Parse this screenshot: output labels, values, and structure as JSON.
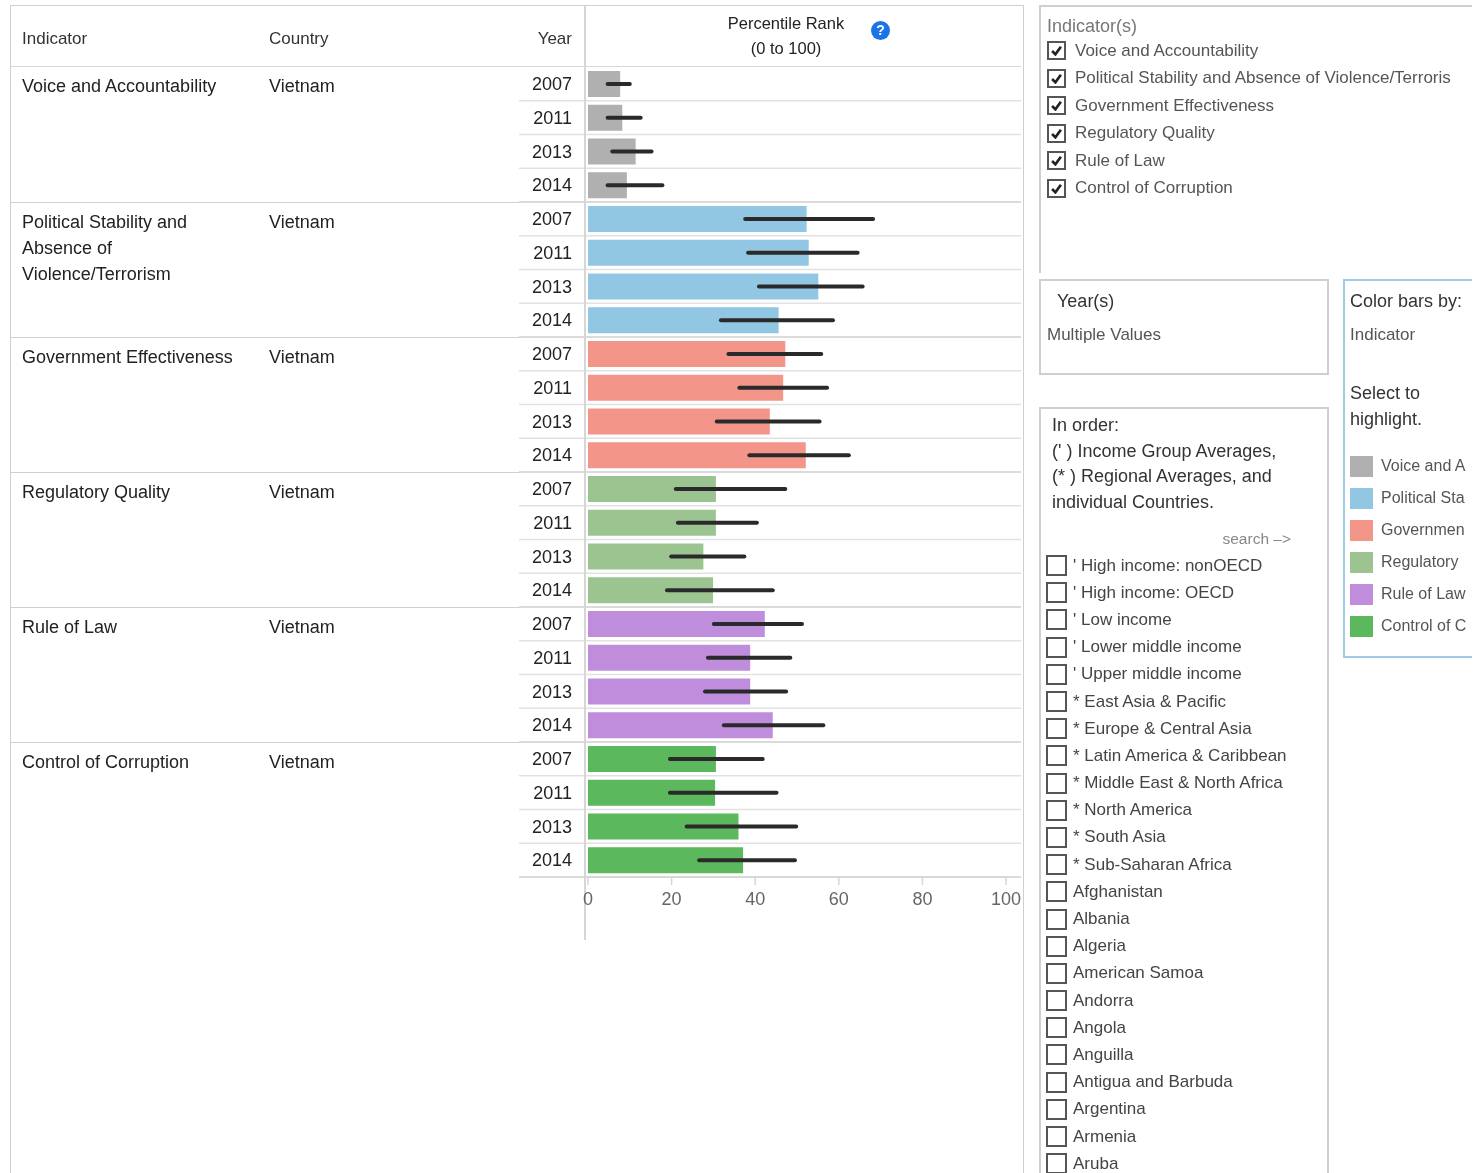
{
  "table": {
    "columns": [
      "Indicator",
      "Country",
      "Year"
    ],
    "groups": [
      {
        "country": "Vietnam"
      },
      {
        "country": "Vietnam"
      },
      {
        "country": "Vietnam"
      },
      {
        "country": "Vietnam"
      },
      {
        "country": "Vietnam"
      },
      {
        "country": "Vietnam"
      }
    ],
    "chart_header": "Percentile Rank\n(0 to 100)",
    "help_icon": "?",
    "chart_data": {
      "type": "bar",
      "orientation": "horizontal",
      "xlim": [
        0,
        100
      ],
      "xticks": [
        0,
        20,
        40,
        60,
        80,
        100
      ],
      "categories": [
        "2007",
        "2011",
        "2013",
        "2014",
        "2007",
        "2011",
        "2013",
        "2014",
        "2007",
        "2011",
        "2013",
        "2014",
        "2007",
        "2011",
        "2013",
        "2014",
        "2007",
        "2011",
        "2013",
        "2014",
        "2007",
        "2011",
        "2013",
        "2014"
      ],
      "series": [
        {
          "name": "Voice and Accountability",
          "color": "#b0b0b0",
          "values": [
            7.7,
            8.2,
            11.4,
            9.3,
            null,
            null,
            null,
            null,
            null,
            null,
            null,
            null,
            null,
            null,
            null,
            null,
            null,
            null,
            null,
            null,
            null,
            null,
            null,
            null
          ],
          "errors": [
            [
              4.7,
              10
            ],
            [
              4.7,
              12.6
            ],
            [
              5.8,
              15.2
            ],
            [
              4.7,
              17.8
            ],
            null,
            null,
            null,
            null,
            null,
            null,
            null,
            null,
            null,
            null,
            null,
            null,
            null,
            null,
            null,
            null,
            null,
            null,
            null,
            null
          ]
        },
        {
          "name": "Political Stability and Absence of Violence/Terrorism",
          "color": "#92c7e3",
          "values": [
            null,
            null,
            null,
            null,
            52.3,
            52.8,
            55.1,
            45.6,
            null,
            null,
            null,
            null,
            null,
            null,
            null,
            null,
            null,
            null,
            null,
            null,
            null,
            null,
            null,
            null
          ],
          "errors": [
            null,
            null,
            null,
            null,
            [
              37.6,
              68.2
            ],
            [
              38.3,
              64.5
            ],
            [
              40.9,
              65.7
            ],
            [
              31.8,
              58.6
            ],
            null,
            null,
            null,
            null,
            null,
            null,
            null,
            null,
            null,
            null,
            null,
            null,
            null,
            null,
            null,
            null
          ]
        },
        {
          "name": "Government Effectiveness",
          "color": "#f4958a",
          "values": [
            null,
            null,
            null,
            null,
            null,
            null,
            null,
            null,
            47.2,
            46.7,
            43.5,
            52.1,
            null,
            null,
            null,
            null,
            null,
            null,
            null,
            null,
            null,
            null,
            null,
            null
          ],
          "errors": [
            null,
            null,
            null,
            null,
            null,
            null,
            null,
            null,
            [
              33.6,
              55.8
            ],
            [
              36.2,
              57.2
            ],
            [
              30.8,
              55.4
            ],
            [
              38.6,
              62.4
            ],
            null,
            null,
            null,
            null,
            null,
            null,
            null,
            null,
            null,
            null,
            null,
            null
          ]
        },
        {
          "name": "Regulatory Quality",
          "color": "#9cc490",
          "values": [
            null,
            null,
            null,
            null,
            null,
            null,
            null,
            null,
            null,
            null,
            null,
            null,
            30.6,
            30.6,
            27.6,
            29.9,
            null,
            null,
            null,
            null,
            null,
            null,
            null,
            null
          ],
          "errors": [
            null,
            null,
            null,
            null,
            null,
            null,
            null,
            null,
            null,
            null,
            null,
            null,
            [
              21,
              47.2
            ],
            [
              21.5,
              40.4
            ],
            [
              19.9,
              37.4
            ],
            [
              18.9,
              44.2
            ],
            null,
            null,
            null,
            null,
            null,
            null,
            null,
            null
          ]
        },
        {
          "name": "Rule of Law",
          "color": "#c08ddd",
          "values": [
            null,
            null,
            null,
            null,
            null,
            null,
            null,
            null,
            null,
            null,
            null,
            null,
            null,
            null,
            null,
            null,
            42.3,
            38.8,
            38.8,
            44.2,
            null,
            null,
            null,
            null
          ],
          "errors": [
            null,
            null,
            null,
            null,
            null,
            null,
            null,
            null,
            null,
            null,
            null,
            null,
            null,
            null,
            null,
            null,
            [
              30.1,
              51.2
            ],
            [
              28.7,
              48.4
            ],
            [
              28,
              47.4
            ],
            [
              32.5,
              56.3
            ],
            null,
            null,
            null,
            null
          ]
        },
        {
          "name": "Control of Corruption",
          "color": "#5cb85c",
          "values": [
            null,
            null,
            null,
            null,
            null,
            null,
            null,
            null,
            null,
            null,
            null,
            null,
            null,
            null,
            null,
            null,
            null,
            null,
            null,
            null,
            30.6,
            30.4,
            36,
            37.1
          ],
          "errors": [
            null,
            null,
            null,
            null,
            null,
            null,
            null,
            null,
            null,
            null,
            null,
            null,
            null,
            null,
            null,
            null,
            null,
            null,
            null,
            null,
            [
              19.6,
              41.8
            ],
            [
              19.6,
              45.1
            ],
            [
              23.6,
              49.8
            ],
            [
              26.6,
              49.5
            ]
          ]
        }
      ]
    }
  },
  "indicator_filter": {
    "title": "Indicator(s)",
    "items": [
      {
        "label": "Voice and Accountability",
        "checked": true
      },
      {
        "label": "Political Stability and Absence of Violence/Terroris",
        "checked": true
      },
      {
        "label": "Government Effectiveness",
        "checked": true
      },
      {
        "label": "Regulatory Quality",
        "checked": true
      },
      {
        "label": "Rule of Law",
        "checked": true
      },
      {
        "label": "Control of Corruption",
        "checked": true
      }
    ]
  },
  "year_filter": {
    "title": "Year(s)",
    "value": "Multiple Values"
  },
  "country_filter": {
    "intro": "In order:\n(' ) Income Group Averages,\n(* ) Regional Averages, and\nindividual Countries.",
    "search_hint": "search –>",
    "items": [
      {
        "label": "' High income: nonOECD",
        "checked": false
      },
      {
        "label": "' High income: OECD",
        "checked": false
      },
      {
        "label": "' Low income",
        "checked": false
      },
      {
        "label": "' Lower middle income",
        "checked": false
      },
      {
        "label": "' Upper middle income",
        "checked": false
      },
      {
        "label": "* East Asia & Pacific",
        "checked": false
      },
      {
        "label": "* Europe & Central Asia",
        "checked": false
      },
      {
        "label": "* Latin America & Caribbean",
        "checked": false
      },
      {
        "label": "* Middle East & North Africa",
        "checked": false
      },
      {
        "label": "* North America",
        "checked": false
      },
      {
        "label": "* South Asia",
        "checked": false
      },
      {
        "label": "* Sub-Saharan Africa",
        "checked": false
      },
      {
        "label": "Afghanistan",
        "checked": false
      },
      {
        "label": "Albania",
        "checked": false
      },
      {
        "label": "Algeria",
        "checked": false
      },
      {
        "label": "American Samoa",
        "checked": false
      },
      {
        "label": "Andorra",
        "checked": false
      },
      {
        "label": "Angola",
        "checked": false
      },
      {
        "label": "Anguilla",
        "checked": false
      },
      {
        "label": "Antigua and Barbuda",
        "checked": false
      },
      {
        "label": "Argentina",
        "checked": false
      },
      {
        "label": "Armenia",
        "checked": false
      },
      {
        "label": "Aruba",
        "checked": false
      }
    ]
  },
  "color_legend": {
    "title": "Color bars by:",
    "value": "Indicator",
    "hint": "Select to\nhighlight.",
    "items": [
      {
        "label": "Voice and A",
        "color": "#b0b0b0"
      },
      {
        "label": "Political Sta",
        "color": "#92c7e3"
      },
      {
        "label": "Governmen",
        "color": "#f4958a"
      },
      {
        "label": "Regulatory",
        "color": "#9cc490"
      },
      {
        "label": "Rule of Law",
        "color": "#c08ddd"
      },
      {
        "label": "Control of C",
        "color": "#5cb85c"
      }
    ]
  }
}
